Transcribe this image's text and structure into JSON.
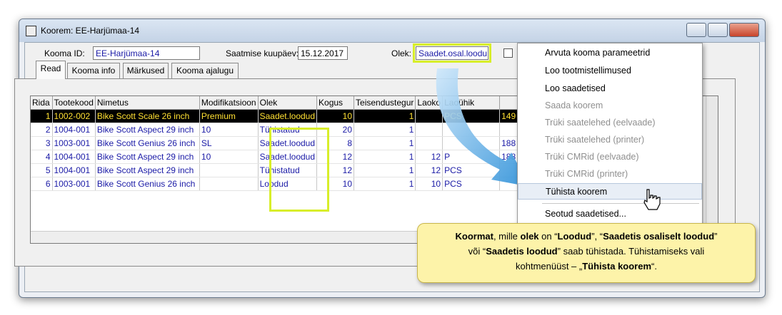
{
  "window": {
    "title": "Koorem: EE-Harjümaa-14"
  },
  "header": {
    "kooma_id_label": "Kooma ID:",
    "kooma_id_value": "EE-Harjümaa-14",
    "date_label": "Saatmise kuupäev:",
    "date_value": "15.12.2017",
    "status_label": "Olek:",
    "status_value": "Saadet.osal.loodu"
  },
  "tabs": [
    {
      "label": "Read"
    },
    {
      "label": "Kooma info"
    },
    {
      "label": "Märkused"
    },
    {
      "label": "Kooma ajalugu"
    }
  ],
  "table": {
    "columns": [
      "Rida",
      "Tootekood",
      "Nimetus",
      "Modifikatsioon",
      "Olek",
      "Kogus",
      "Teisendustegur",
      "Laoko",
      "Laoühik"
    ],
    "rows": [
      {
        "rida": "1",
        "kood": "1002-002",
        "nimi": "Bike Scott Scale 26 inch",
        "mod": "Premium",
        "olek": "Saadet.loodud",
        "kogus": "10",
        "teis": "1",
        "laoko": "",
        "uhik": "PCS",
        "extra": "149"
      },
      {
        "rida": "2",
        "kood": "1004-001",
        "nimi": "Bike Scott Aspect 29 inch",
        "mod": "10",
        "olek": "Tühistatud",
        "kogus": "20",
        "teis": "1",
        "laoko": "",
        "uhik": "",
        "extra": ""
      },
      {
        "rida": "3",
        "kood": "1003-001",
        "nimi": "Bike Scott Genius 26 inch",
        "mod": "SL",
        "olek": "Saadet.loodud",
        "kogus": "8",
        "teis": "1",
        "laoko": "",
        "uhik": "",
        "extra": "188"
      },
      {
        "rida": "4",
        "kood": "1004-001",
        "nimi": "Bike Scott Aspect 29 inch",
        "mod": "10",
        "olek": "Saadet.loodud",
        "kogus": "12",
        "teis": "1",
        "laoko": "12",
        "uhik": "P",
        "extra": "188"
      },
      {
        "rida": "5",
        "kood": "1004-001",
        "nimi": "Bike Scott Aspect 29 inch",
        "mod": "",
        "olek": "Tühistatud",
        "kogus": "12",
        "teis": "1",
        "laoko": "12",
        "uhik": "PCS",
        "extra": ""
      },
      {
        "rida": "6",
        "kood": "1003-001",
        "nimi": "Bike Scott Genius 26 inch",
        "mod": "",
        "olek": "Loodud",
        "kogus": "10",
        "teis": "1",
        "laoko": "10",
        "uhik": "PCS",
        "extra": ""
      }
    ]
  },
  "menu": {
    "items": [
      {
        "label": "Arvuta kooma parameetrid",
        "enabled": true
      },
      {
        "label": "Loo tootmistellimused",
        "enabled": true
      },
      {
        "label": "Loo saadetised",
        "enabled": true
      },
      {
        "label": "Saada koorem",
        "enabled": false
      },
      {
        "label": "Trüki saatelehed (eelvaade)",
        "enabled": false
      },
      {
        "label": "Trüki saatelehed (printer)",
        "enabled": false
      },
      {
        "label": "Trüki CMRid (eelvaade)",
        "enabled": false
      },
      {
        "label": "Trüki CMRid (printer)",
        "enabled": false
      },
      {
        "label": "Tühista koorem",
        "enabled": true
      },
      {
        "label": "Seotud saadetised...",
        "enabled": true
      }
    ]
  },
  "callout": {
    "p1": "Koormat",
    "p2": ", mille ",
    "p3": "olek",
    "p4": " on “",
    "p5": "Loodud",
    "p6": "”, “",
    "p7": "Saadetis osaliselt loodud",
    "p8": "”",
    "p9": "või “",
    "p10": "Saadetis loodud",
    "p11": "” saab tühistada. Tühistamiseks vali",
    "p12": "kohtmenüüst – „",
    "p13": "Tühista koorem",
    "p14": "“."
  },
  "colors": {
    "accent_highlight": "#d8ee2a",
    "selected_row_bg": "#000000",
    "selected_row_fg": "#ffe033",
    "link_blue": "#1a1aa6",
    "callout_bg": "#fdf3a9"
  }
}
